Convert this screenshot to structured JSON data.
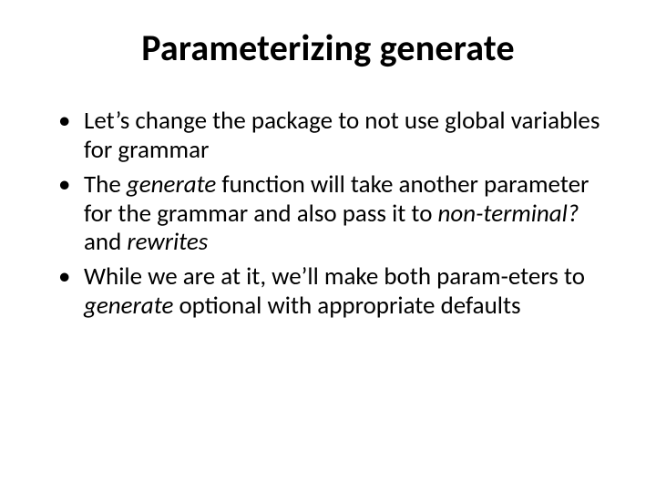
{
  "slide": {
    "title": "Parameterizing generate",
    "bullets": [
      {
        "segments": [
          {
            "text": "Let’s change the package to not use global variables for grammar",
            "style": "plain"
          }
        ]
      },
      {
        "segments": [
          {
            "text": "The ",
            "style": "plain"
          },
          {
            "text": "generate",
            "style": "ital"
          },
          {
            "text": " function will take another parameter for the grammar and also pass it to ",
            "style": "plain"
          },
          {
            "text": "non-terminal?",
            "style": "ital"
          },
          {
            "text": " and ",
            "style": "plain"
          },
          {
            "text": "rewrites",
            "style": "ital"
          }
        ]
      },
      {
        "segments": [
          {
            "text": "While we are at it, we’ll make both param-eters to ",
            "style": "plain"
          },
          {
            "text": "generate",
            "style": "ital"
          },
          {
            "text": " optional with appropriate defaults",
            "style": "plain"
          }
        ]
      }
    ]
  }
}
